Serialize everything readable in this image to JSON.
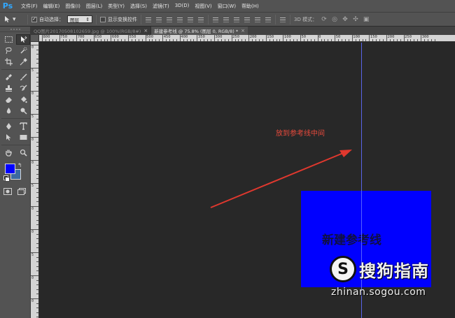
{
  "app": {
    "logo": "Ps"
  },
  "menu": {
    "items": [
      "文件(F)",
      "编辑(E)",
      "图像(I)",
      "图层(L)",
      "类型(Y)",
      "选择(S)",
      "滤镜(T)",
      "3D(D)",
      "视图(V)",
      "窗口(W)",
      "帮助(H)"
    ]
  },
  "options": {
    "auto_select_label": "自动选择：",
    "auto_select_checked": true,
    "auto_select_target": "图层",
    "show_transform_label": "显示变换控件",
    "show_transform_checked": false,
    "mode3d_label": "3D 模式："
  },
  "tabs": [
    {
      "label": "QQ图片20170508102659.jpg @ 100%(RGB/8#)",
      "active": false
    },
    {
      "label": "新建参考线 @ 75.8% (图层 0, RGB/8) *",
      "active": true
    }
  ],
  "rulers": {
    "horizontal_labels": [
      "800",
      "750",
      "700",
      "650",
      "600",
      "550",
      "500",
      "450",
      "400",
      "350",
      "300",
      "250",
      "200",
      "150",
      "100",
      "50",
      "0",
      "50",
      "100",
      "150",
      "200",
      "250",
      "300"
    ],
    "vertical_labels": [
      "0",
      "5",
      "0",
      "5",
      "0",
      "0",
      "5",
      "0",
      "0",
      "5",
      "0",
      "0"
    ]
  },
  "colors": {
    "foreground": "#0000ff",
    "background": "#3b6aa0",
    "guide": "#5e6cff",
    "annotation": "#e84a3c"
  },
  "canvas": {
    "shape_text": "新建参考线",
    "annotation_text": "放到参考线中间"
  },
  "watermark": {
    "logo_glyph": "S",
    "brand": "搜狗指南",
    "url": "zhinan.sogou.com"
  }
}
